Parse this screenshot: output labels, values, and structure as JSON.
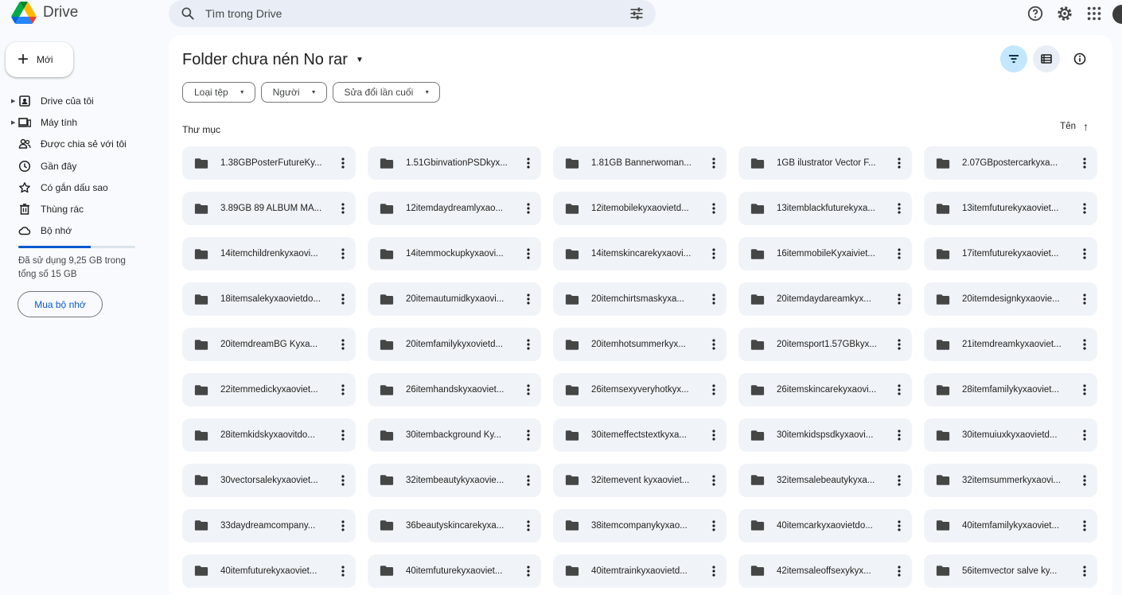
{
  "app": {
    "name": "Drive"
  },
  "search": {
    "placeholder": "Tìm trong Drive"
  },
  "sidebar": {
    "new_label": "Mới",
    "items": [
      {
        "label": "Drive của tôi",
        "icon": "my-drive-icon",
        "expandable": true
      },
      {
        "label": "Máy tính",
        "icon": "computer-icon",
        "expandable": true
      },
      {
        "label": "Được chia sẻ với tôi",
        "icon": "shared-icon",
        "expandable": false
      },
      {
        "label": "Gần đây",
        "icon": "clock-icon",
        "expandable": false
      },
      {
        "label": "Có gắn dấu sao",
        "icon": "star-icon",
        "expandable": false
      },
      {
        "label": "Thùng rác",
        "icon": "trash-icon",
        "expandable": false
      },
      {
        "label": "Bộ nhớ",
        "icon": "cloud-icon",
        "expandable": false
      }
    ],
    "storage_used_fraction": 0.617,
    "storage_text": "Đã sử dụng 9,25 GB trong tổng số 15 GB",
    "buy_label": "Mua bộ nhớ"
  },
  "main": {
    "title": "Folder chưa nén No rar",
    "filters": [
      "Loại tệp",
      "Người",
      "Sửa đổi lần cuối"
    ],
    "section_label": "Thư mục",
    "sort_label": "Tên",
    "folders": [
      "1.38GBPosterFutureKy...",
      "1.51GbinvationPSDkyx...",
      "1.81GB Bannerwoman...",
      "1GB ilustrator Vector F...",
      "2.07GBpostercarkyxa...",
      "3.89GB 89 ALBUM MA...",
      "12itemdaydreamlyxao...",
      "12itemobilekyxaovietd...",
      "13itemblackfuturekyxa...",
      "13itemfuturekyxaoviet...",
      "14itemchildrenkyxaovi...",
      "14itemmockupkyxaovi...",
      "14itemskincarekyxaovi...",
      "16itemmobileKyxaiviet...",
      "17itemfuturekyxaoviet...",
      "18itemsalekyxaovietdo...",
      "20itemautumidkyxaovi...",
      "20itemchirtsmaskyxa...",
      "20itemdaydareamkyx...",
      "20itemdesignkyxaovie...",
      "20itemdreamBG Kyxa...",
      "20itemfamilykyxovietd...",
      "20itemhotsummerkyx...",
      "20itemsport1.57GBkyx...",
      "21itemdreamkyxaoviet...",
      "22itemmedickyxaoviet...",
      "26itemhandskyxaoviet...",
      "26itemsexyveryhotkyx...",
      "26itemskincarekyxaovi...",
      "28itemfamilykyxaoviet...",
      "28itemkidskyxaovitdo...",
      "30itembackground Ky...",
      "30itemeffectstextkyxa...",
      "30itemkidspsdkyxaovi...",
      "30itemuiuxkyxaovietd...",
      "30vectorsalekyxaoviet...",
      "32itembeautykyxaovie...",
      "32itemevent kyxaoviet...",
      "32itemsalebeautykyxa...",
      "32itemsummerkyxaovi...",
      "33daydreamcompany...",
      "36beautyskincarekyxa...",
      "38itemcompanykyxao...",
      "40itemcarkyxaovietdo...",
      "40itemfamilykyxaoviet...",
      "40itemfuturekyxaoviet...",
      "40itemfuturekyxaoviet...",
      "40itemtrainkyxaovietd...",
      "42itemsaleoffsexykyx...",
      "56itemvector salve ky..."
    ]
  },
  "colors": {
    "accent": "#0b57d0",
    "card_bg": "#f0f4f9",
    "page_bg": "#f8fafd",
    "selected_view_bg": "#c2e7ff"
  }
}
